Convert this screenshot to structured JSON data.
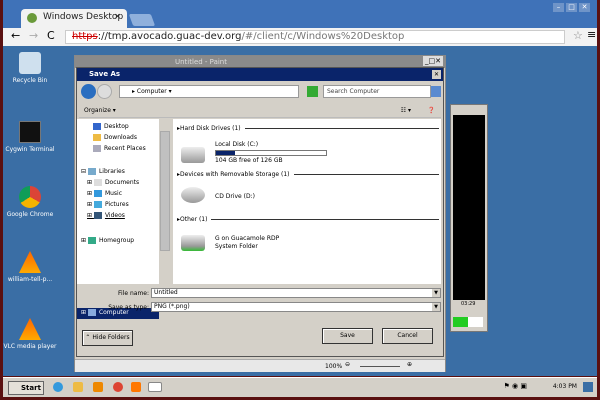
{
  "browser": {
    "tab_title": "Windows Desktop",
    "url_scheme": "https",
    "url_host": "://tmp.avocado.guac-dev.org",
    "url_path": "/#/client/c/Windows%20Desktop"
  },
  "desktop": {
    "icons": [
      {
        "label": "Recycle Bin",
        "icon": "recycle-bin-icon"
      },
      {
        "label": "Cygwin Terminal",
        "icon": "terminal-icon"
      },
      {
        "label": "Google Chrome",
        "icon": "chrome-icon"
      },
      {
        "label": "william-tell-p...",
        "icon": "vlc-icon"
      },
      {
        "label": "VLC media player",
        "icon": "vlc-icon"
      }
    ]
  },
  "paint": {
    "title": "Untitled - Paint",
    "zoom": "100%"
  },
  "dialog": {
    "title": "Save As",
    "breadcrumb": "Computer",
    "search_placeholder": "Search Computer",
    "organize": "Organize",
    "nav": [
      "Desktop",
      "Downloads",
      "Recent Places",
      "Libraries",
      "Documents",
      "Music",
      "Pictures",
      "Videos",
      "Homegroup",
      "Computer"
    ],
    "groups": [
      {
        "header": "Hard Disk Drives (1)",
        "items": [
          {
            "name": "Local Disk (C:)",
            "detail": "104 GB free of 126 GB",
            "used_fraction": 0.17
          }
        ]
      },
      {
        "header": "Devices with Removable Storage (1)",
        "items": [
          {
            "name": "CD Drive (D:)"
          }
        ]
      },
      {
        "header": "Other (1)",
        "items": [
          {
            "name": "G on Guacamole RDP",
            "detail": "System Folder"
          }
        ]
      }
    ],
    "file_name_label": "File name:",
    "file_name": "Untitled",
    "type_label": "Save as type:",
    "type": "PNG (*.png)",
    "hide_folders": "Hide Folders",
    "save": "Save",
    "cancel": "Cancel"
  },
  "vlc": {
    "time": "03:29"
  },
  "taskbar": {
    "start": "Start",
    "clock": "4:03 PM"
  }
}
